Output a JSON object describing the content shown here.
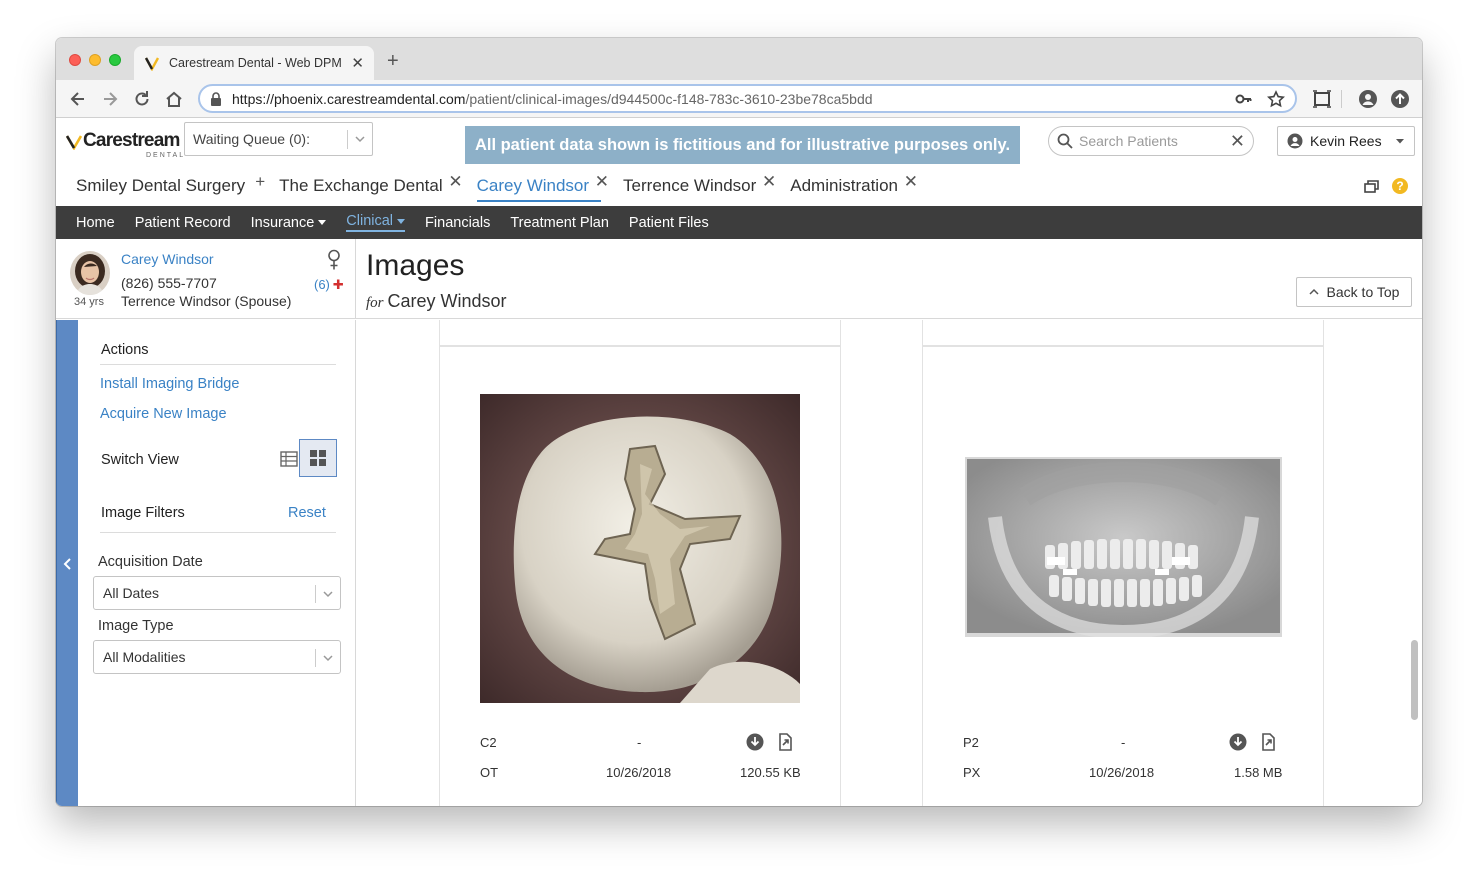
{
  "browser": {
    "tab_title": "Carestream Dental - Web DPM",
    "url_host": "https://phoenix.carestreamdental.com",
    "url_path": "/patient/clinical-images/d944500c-f148-783c-3610-23be78ca5bdd"
  },
  "header": {
    "logo_text": "Carestream",
    "logo_sub": "DENTAL",
    "waiting_queue": "Waiting Queue (0):",
    "banner": "All patient data shown is fictitious and for illustrative purposes only.",
    "search_placeholder": "Search Patients",
    "user_name": "Kevin Rees"
  },
  "patient_tabs": [
    {
      "label": "Smiley Dental Surgery",
      "close": "+"
    },
    {
      "label": "The Exchange Dental",
      "close": "✕"
    },
    {
      "label": "Carey Windsor",
      "close": "✕"
    },
    {
      "label": "Terrence Windsor",
      "close": "✕"
    },
    {
      "label": "Administration",
      "close": "✕"
    }
  ],
  "nav": {
    "items": [
      "Home",
      "Patient Record",
      "Insurance",
      "Clinical",
      "Financials",
      "Treatment Plan",
      "Patient Files"
    ]
  },
  "patient": {
    "name": "Carey Windsor",
    "phone": "(826) 555-7707",
    "spouse": "Terrence Windsor (Spouse)",
    "age": "34 yrs",
    "alerts": "(6)"
  },
  "page": {
    "title": "Images",
    "for_label": "for",
    "for_name": "Carey Windsor",
    "back_to_top": "Back to Top"
  },
  "sidebar": {
    "actions_heading": "Actions",
    "install_link": "Install Imaging Bridge",
    "acquire_link": "Acquire New Image",
    "switch_view": "Switch View",
    "filters_heading": "Image Filters",
    "reset": "Reset",
    "acq_date_label": "Acquisition Date",
    "acq_date_value": "All Dates",
    "image_type_label": "Image Type",
    "image_type_value": "All Modalities"
  },
  "images": [
    {
      "tooth": "C2",
      "dash": "-",
      "type": "OT",
      "date": "10/26/2018",
      "size": "120.55 KB"
    },
    {
      "tooth": "P2",
      "dash": "-",
      "type": "PX",
      "date": "10/26/2018",
      "size": "1.58 MB"
    }
  ],
  "colors": {
    "accent": "#3a82c5",
    "navbar": "#3d3d3d",
    "banner": "#8db0c8",
    "collapser": "#5d89c4"
  }
}
